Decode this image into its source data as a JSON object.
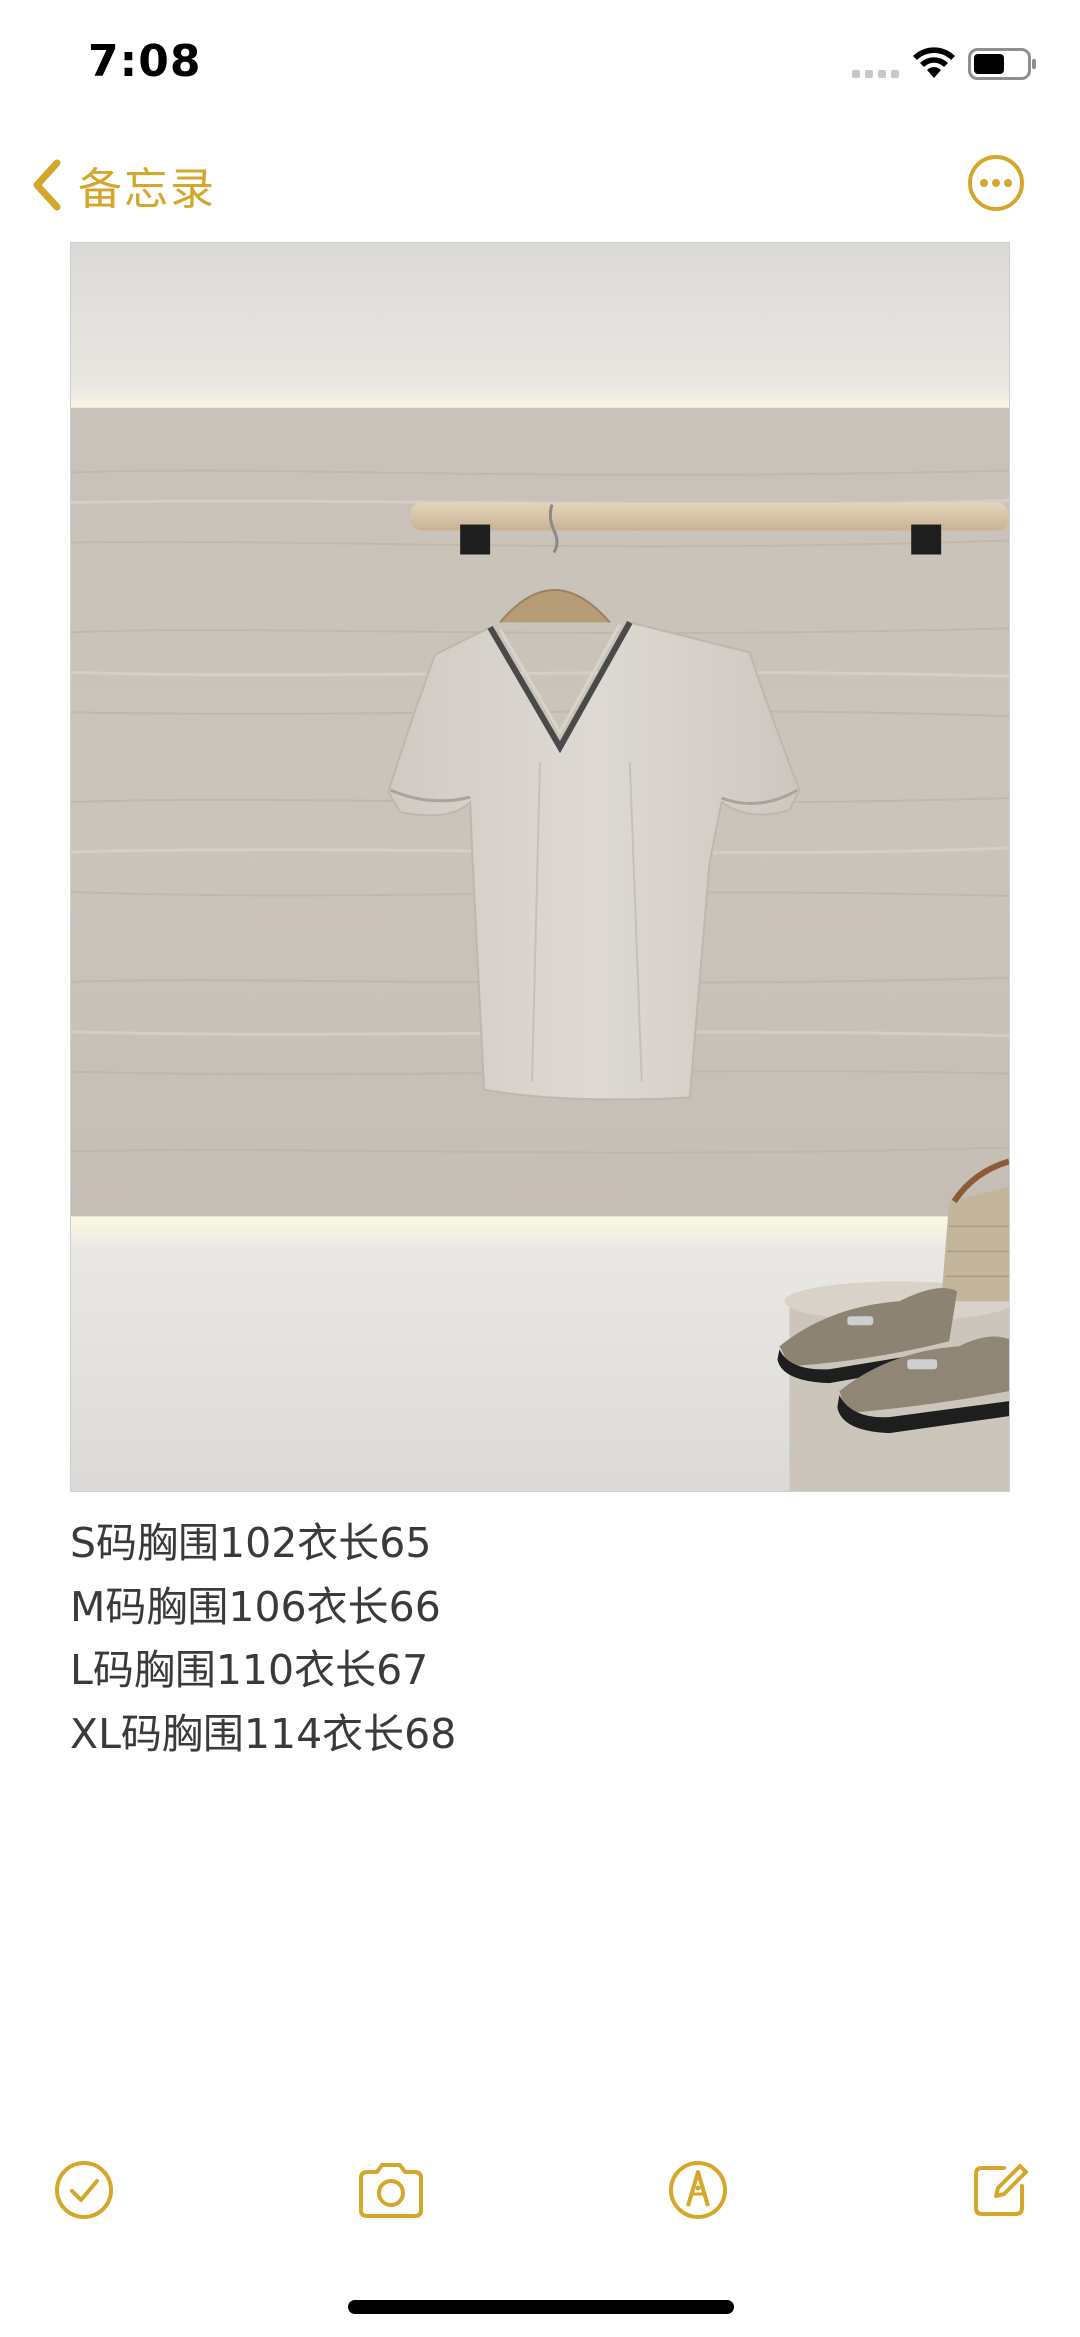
{
  "status_bar": {
    "time": "7:08",
    "icons": [
      "signal-icon",
      "wifi-icon",
      "battery-icon"
    ]
  },
  "nav": {
    "back_label": "备忘录",
    "back_icon": "chevron-left-icon",
    "more_icon": "ellipsis-circle-icon"
  },
  "colors": {
    "accent": "#D4A72C",
    "text": "#3A3A3C",
    "background": "#FFFFFF"
  },
  "note": {
    "image_icon": "product-photo",
    "lines": [
      "S码胸围102衣长65",
      "M码胸围106衣长66",
      "L码胸围110衣长67",
      "XL码胸围114衣长68"
    ]
  },
  "toolbar": {
    "checklist_icon": "checkmark-circle-icon",
    "camera_icon": "camera-icon",
    "markup_icon": "pen-tip-circle-icon",
    "compose_icon": "compose-icon"
  }
}
